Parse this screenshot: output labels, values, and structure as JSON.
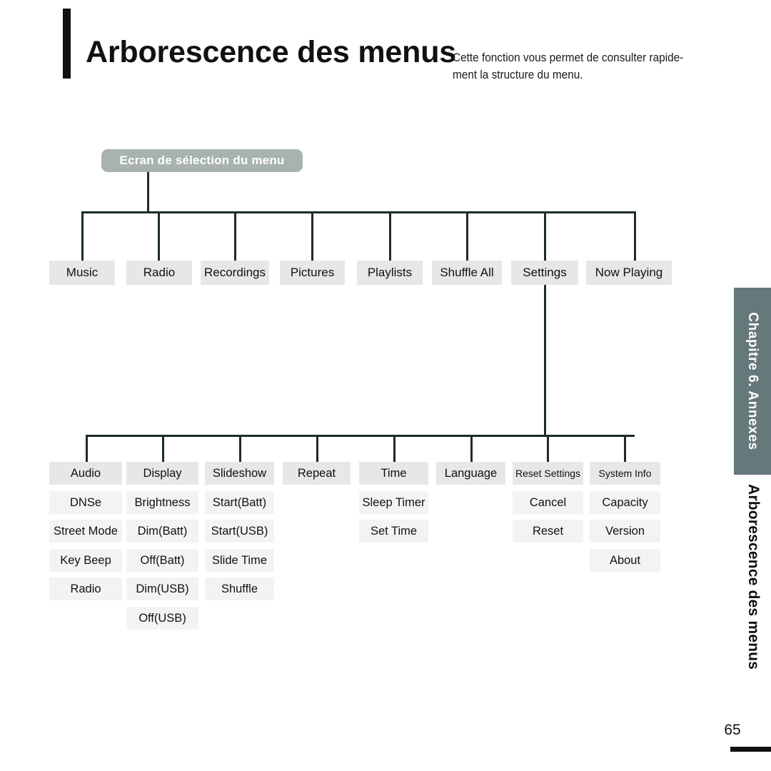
{
  "header": {
    "title": "Arborescence des menus",
    "subtitle": "Cette fonction vous permet de consulter rapide-ment la structure du menu."
  },
  "tree": {
    "root": {
      "label": "Ecran de sélection du menu"
    },
    "level1": [
      {
        "label": "Music"
      },
      {
        "label": "Radio"
      },
      {
        "label": "Recordings"
      },
      {
        "label": "Pictures"
      },
      {
        "label": "Playlists"
      },
      {
        "label": "Shuffle All"
      },
      {
        "label": "Settings"
      },
      {
        "label": "Now Playing"
      }
    ],
    "settings_columns": [
      {
        "head": "Audio",
        "items": [
          "DNSe",
          "Street Mode",
          "Key Beep",
          "Radio"
        ]
      },
      {
        "head": "Display",
        "items": [
          "Brightness",
          "Dim(Batt)",
          "Off(Batt)",
          "Dim(USB)",
          "Off(USB)"
        ]
      },
      {
        "head": "Slideshow",
        "items": [
          "Start(Batt)",
          "Start(USB)",
          "Slide Time",
          "Shuffle"
        ]
      },
      {
        "head": "Repeat",
        "items": []
      },
      {
        "head": "Time",
        "items": [
          "Sleep Timer",
          "Set Time"
        ]
      },
      {
        "head": "Language",
        "items": []
      },
      {
        "head": "Reset Settings",
        "items": [
          "Cancel",
          "Reset"
        ]
      },
      {
        "head": "System Info",
        "items": [
          "Capacity",
          "Version",
          "About"
        ]
      }
    ]
  },
  "margin": {
    "chapter_tab": "Chapitre 6.  Annexes",
    "section_title": "Arborescence des menus",
    "page_number": "65"
  },
  "colors": {
    "root_node_bg": "#a8b2b0",
    "node_bg": "#e5e8e7",
    "subitem_bg": "#f2f4f3",
    "connector": "#1d2b2b",
    "tab_bg": "#65787a",
    "text": "#111111"
  }
}
